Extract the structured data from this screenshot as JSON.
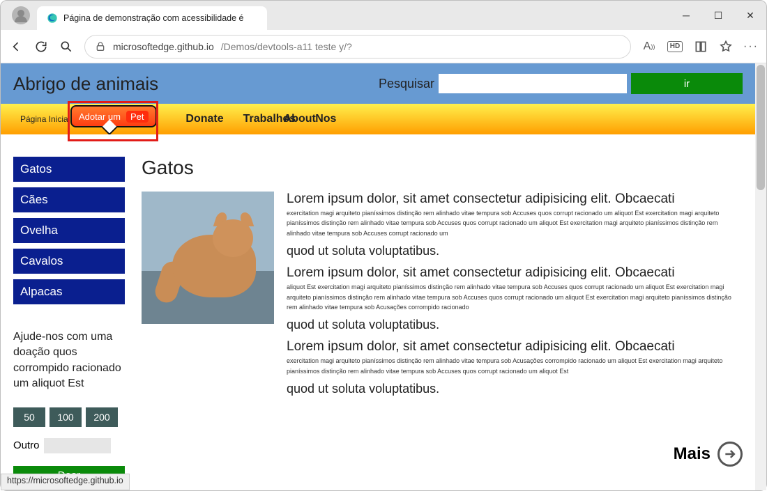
{
  "browser": {
    "tab_title": "Página de demonstração com acessibilidade é",
    "url_host": "microsoftedge.github.io",
    "url_path": "/Demos/devtools-a11 teste y/?",
    "status_url": "https://microsoftedge.github.io"
  },
  "header": {
    "site_title": "Abrigo de animais",
    "search_label": "Pesquisar",
    "go_label": "ir"
  },
  "nav": {
    "home": "Página Inicial",
    "adopt_prefix": "Adotar um",
    "adopt_pill": "Pet",
    "donate": "Donate",
    "jobs": "Trabalhos",
    "about": "About",
    "us": "Nos"
  },
  "sidebar": {
    "items": [
      "Gatos",
      "Cães",
      "Ovelha",
      "Cavalos",
      "Alpacas"
    ],
    "donate_blurb": "Ajude-nos com uma doação quos corrompido racionado um aliquot Est",
    "amounts": [
      "50",
      "100",
      "200"
    ],
    "other_label": "Outro",
    "donate_btn": "Doar"
  },
  "main": {
    "heading": "Gatos",
    "lead": "Lorem ipsum dolor, sit amet consectetur adipisicing elit. Obcaecati",
    "tiny1": "exercitation magi arquiteto pianíssimos distinção rem alinhado vitae tempura sob Accuses quos corrupt racionado um aliquot Est exercitation magi arquiteto pianíssimos distinção rem alinhado vitae tempura sob Accuses quos corrupt racionado um aliquot Est exercitation magi arquiteto pianíssimos distinção rem alinhado vitae tempura sob Accuses corrupt racionado um",
    "med": "quod ut soluta voluptatibus.",
    "tiny2": "aliquot Est exercitation magi arquiteto pianíssimos distinção rem alinhado vitae tempura sob Accuses quos corrupt racionado um aliquot Est exercitation magi arquiteto pianíssimos distinção rem alinhado vitae tempura sob Accuses quos corrupt racionado um aliquot Est exercitation magi arquiteto pianíssimos distinção rem alinhado vitae tempura sob Acusações corrompido racionado",
    "tiny3": "exercitation magi arquiteto pianíssimos distinção rem alinhado vitae tempura sob Acusações corrompido racionado um aliquot Est exercitation magi arquiteto pianíssimos distinção rem alinhado vitae tempura sob Accuses quos corrupt racionado um aliquot Est",
    "more": "Mais"
  }
}
